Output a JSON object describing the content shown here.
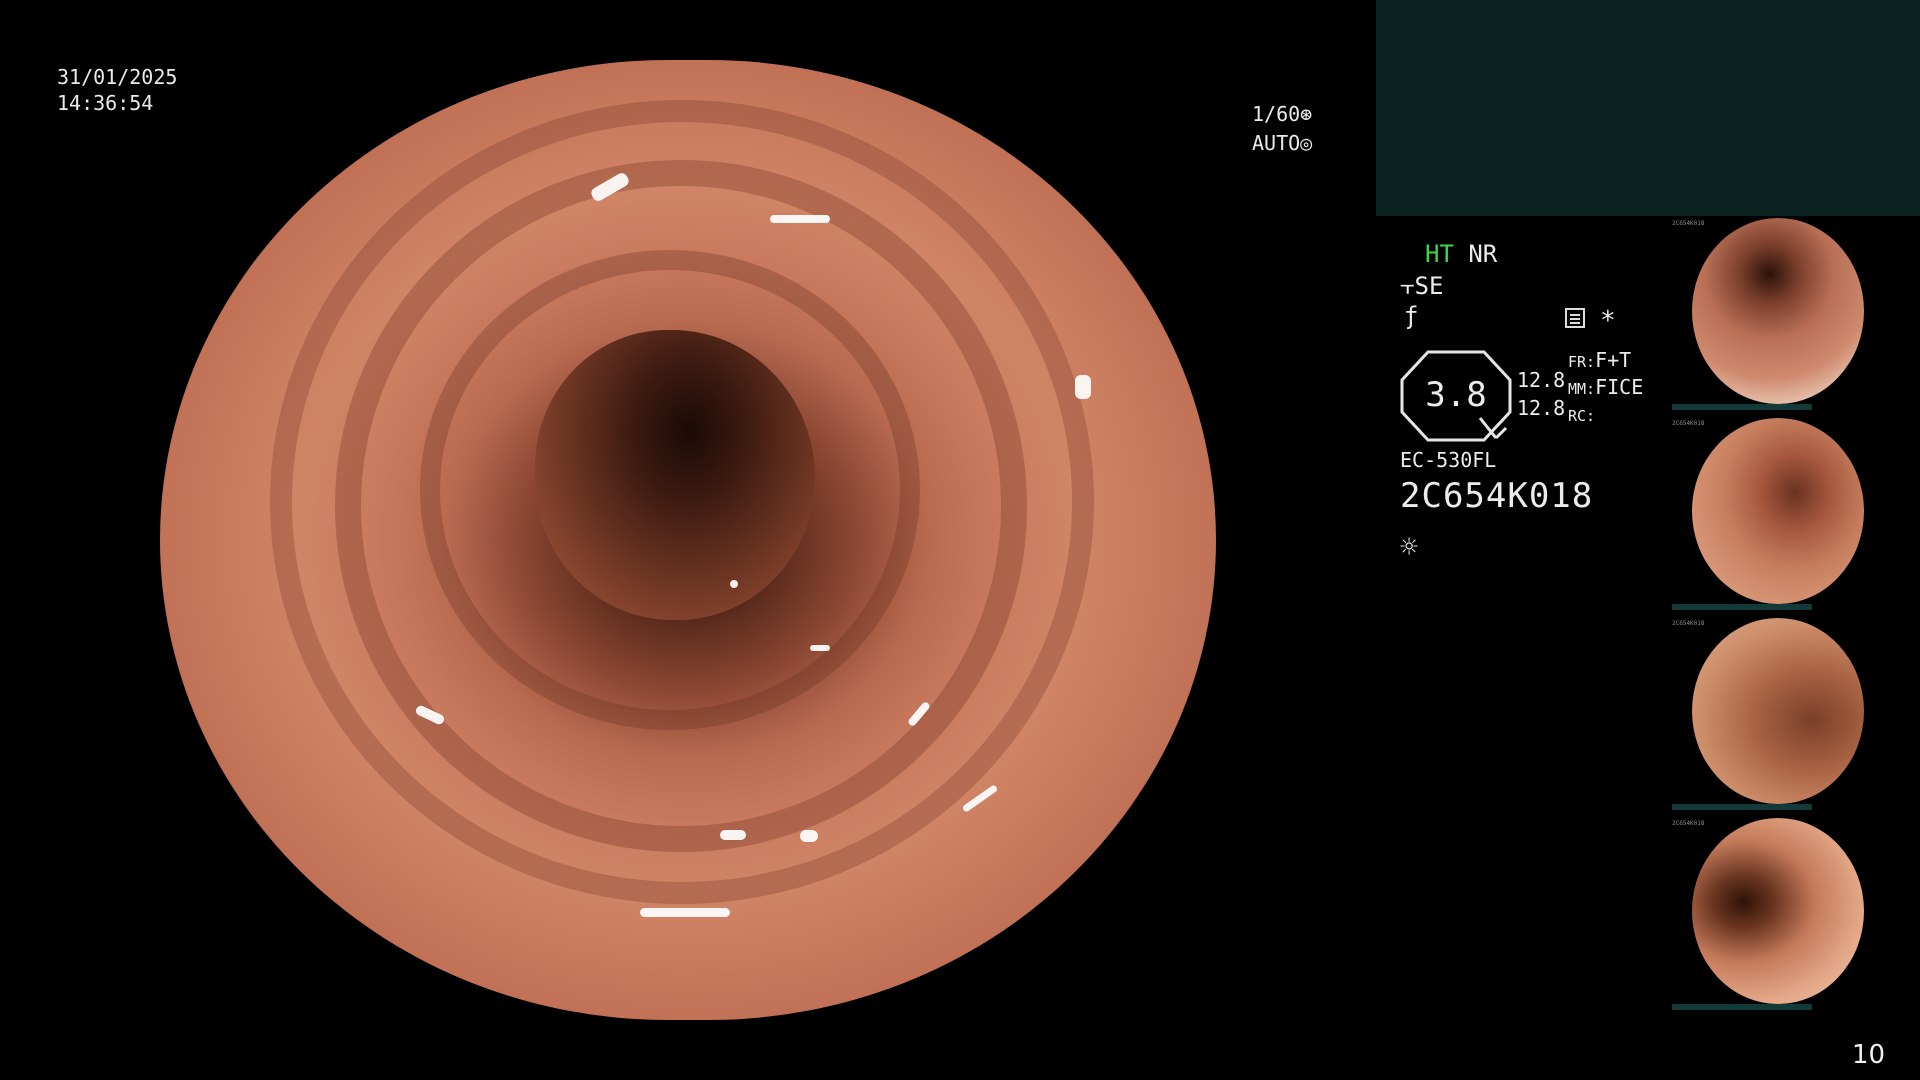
{
  "overlay": {
    "date": "31/01/2025",
    "time": "14:36:54",
    "shutter": "1/60",
    "iris": "AUTO"
  },
  "panel": {
    "ht": "HT",
    "nr": "NR",
    "se": "SE",
    "enhance_value": "3.8",
    "meas_top": "12.8",
    "meas_bottom": "12.8",
    "fr_key": "FR:",
    "fr_val": "F+T",
    "mm_key": "MM:",
    "mm_val": "FICE",
    "rc_key": "RC:",
    "rc_val": "",
    "scope_model": "EC-530FL",
    "serial": "2C654K018",
    "star": "*",
    "colors": {
      "ht_green": "#3bd64a",
      "topbox": "#092220"
    }
  },
  "thumbnails": [
    {
      "id": "thumb-1",
      "tag": "2C654K018"
    },
    {
      "id": "thumb-2",
      "tag": "2C654K018"
    },
    {
      "id": "thumb-3",
      "tag": "2C654K018"
    },
    {
      "id": "thumb-4",
      "tag": "2C654K018"
    }
  ],
  "page_number": "10"
}
